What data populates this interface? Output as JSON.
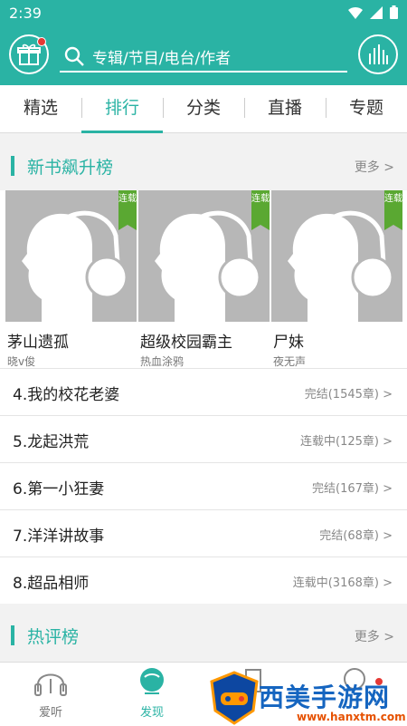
{
  "status": {
    "time": "2:39"
  },
  "search": {
    "placeholder": "专辑/节目/电台/作者"
  },
  "tabs": [
    {
      "label": "精选"
    },
    {
      "label": "排行",
      "active": true
    },
    {
      "label": "分类"
    },
    {
      "label": "直播"
    },
    {
      "label": "专题"
    }
  ],
  "section1": {
    "title": "新书飙升榜",
    "more": "更多 >"
  },
  "cards": [
    {
      "name": "茅山遗孤",
      "author": "晓v俊",
      "badge": "连载"
    },
    {
      "name": "超级校园霸主",
      "author": "热血涂鸦",
      "badge": "连载"
    },
    {
      "name": "尸妹",
      "author": "夜无声",
      "badge": "连载"
    }
  ],
  "rows": [
    {
      "title": "4.我的校花老婆",
      "status": "完结(1545章) >"
    },
    {
      "title": "5.龙起洪荒",
      "status": "连载中(125章) >"
    },
    {
      "title": "6.第一小狂妻",
      "status": "完结(167章) >"
    },
    {
      "title": "7.洋洋讲故事",
      "status": "完结(68章) >"
    },
    {
      "title": "8.超品相师",
      "status": "连载中(3168章) >"
    }
  ],
  "section2": {
    "title": "热评榜",
    "more": "更多 >"
  },
  "nav": [
    {
      "label": "爱听"
    },
    {
      "label": "发现",
      "active": true
    },
    {
      "label": ""
    },
    {
      "label": ""
    }
  ],
  "watermark": {
    "brand": "西美手游网",
    "url": "www.hanxtm.com"
  },
  "colors": {
    "accent": "#2ab3a4",
    "badge": "#5aa832"
  }
}
